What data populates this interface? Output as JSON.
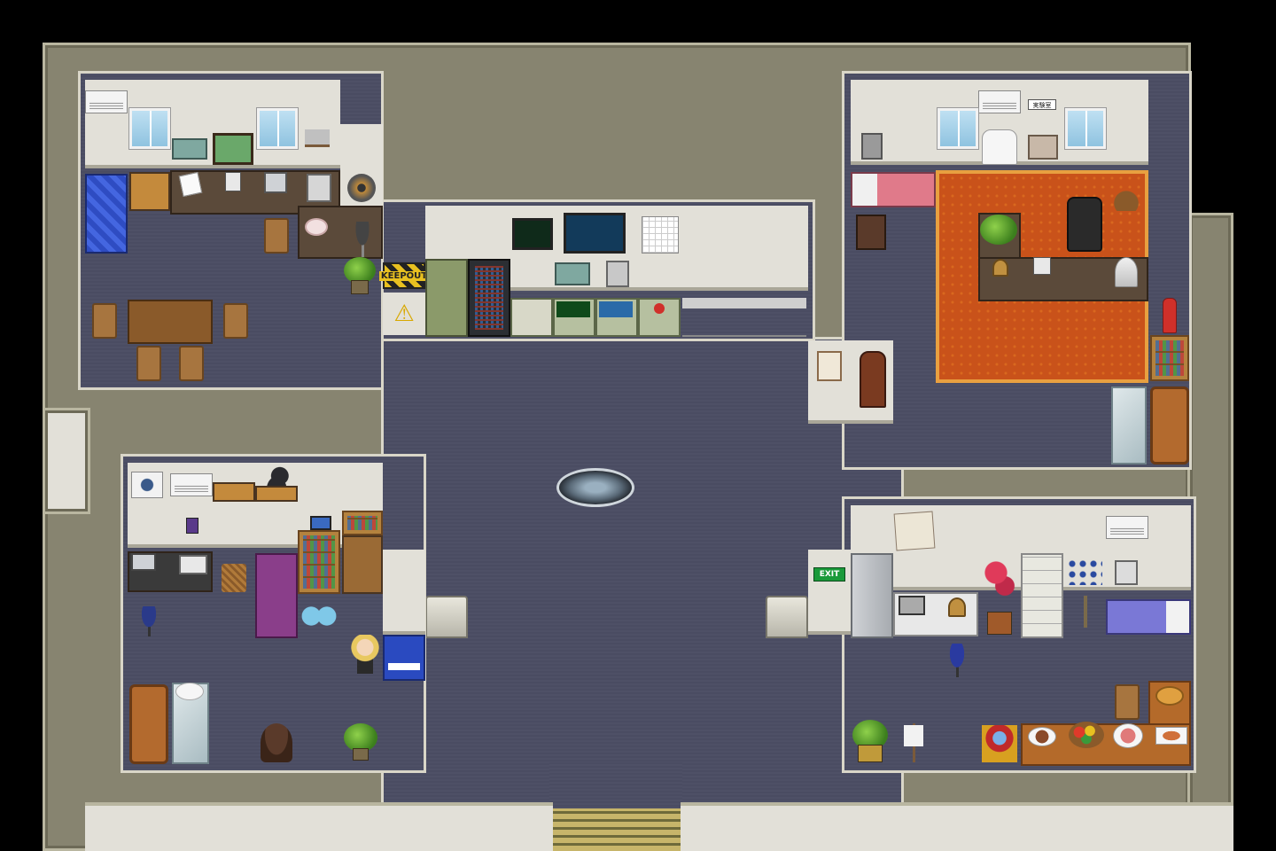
{
  "scene": {
    "type": "rpg-map",
    "location": "laboratory-floor",
    "signs": {
      "keepout": "KEEPOUT",
      "exit": "EXIT",
      "door_plate": "実験室"
    },
    "colors": {
      "floor": "#4a4c62",
      "outer_wall": "#878470",
      "wall_plaster": "#e2e0d8",
      "carpet": "#c9521a"
    },
    "icons": [
      "warning-icon",
      "fire-extinguisher-icon",
      "monitor-icon",
      "telephone-icon",
      "clock-icon",
      "plant-icon",
      "cat-icon",
      "teleporter-icon",
      "character-sprite-icon"
    ]
  }
}
